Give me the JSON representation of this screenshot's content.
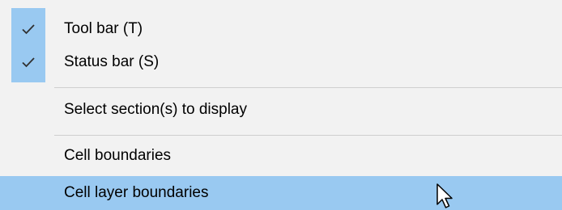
{
  "menu": {
    "items": [
      {
        "label": "Tool bar (T)",
        "checked": true,
        "icon": "checkmark-icon"
      },
      {
        "label": "Status bar (S)",
        "checked": true,
        "icon": "checkmark-icon"
      },
      {
        "label": "Select section(s) to display",
        "checked": false
      },
      {
        "label": "Cell boundaries",
        "checked": false
      },
      {
        "label": "Cell layer boundaries",
        "checked": false,
        "highlighted": true
      }
    ]
  },
  "colors": {
    "menu_background": "#f2f2f2",
    "highlight": "#99c9f1",
    "separator": "#cfcfcf",
    "text": "#000000"
  },
  "cursor": {
    "icon": "mouse-pointer-icon"
  }
}
